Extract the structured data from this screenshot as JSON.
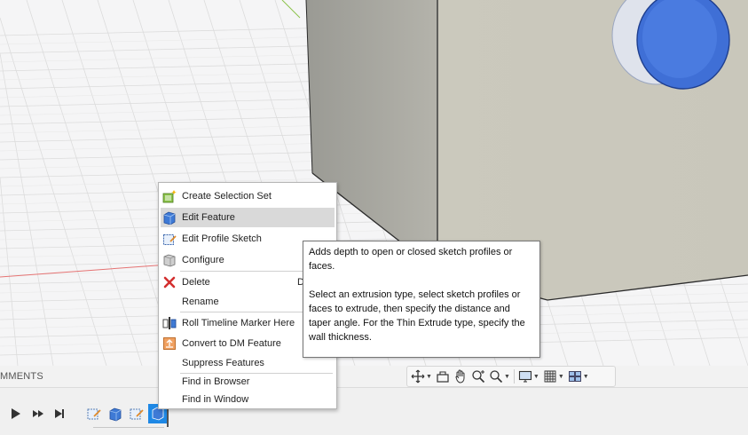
{
  "viewport": {
    "label": "3d-viewport"
  },
  "comments": {
    "label": "MMENTS"
  },
  "context_menu": {
    "items": [
      {
        "label": "Create Selection Set",
        "icon": "selection-set-icon"
      },
      {
        "label": "Edit Feature",
        "icon": "extrude-feature-icon",
        "highlighted": true
      },
      {
        "label": "Edit Profile Sketch",
        "icon": "profile-sketch-icon"
      },
      {
        "label": "Configure",
        "icon": "configure-icon"
      },
      {
        "label": "Delete",
        "icon": "delete-icon",
        "shortcut": "D"
      },
      {
        "label": "Rename",
        "icon": ""
      },
      {
        "label": "Roll Timeline Marker Here",
        "icon": "timeline-marker-icon"
      },
      {
        "label": "Convert to DM Feature",
        "icon": "convert-dm-icon"
      },
      {
        "label": "Suppress Features",
        "icon": ""
      },
      {
        "label": "Find in Browser",
        "icon": ""
      },
      {
        "label": "Find in Window",
        "icon": ""
      }
    ]
  },
  "tooltip": {
    "summary": "Adds depth to open or closed sketch profiles or faces.",
    "detail": "Select an extrusion type, select sketch profiles or faces to extrude, then specify the distance and taper angle. For the Thin Extrude type, specify the wall thickness."
  },
  "nav_toolbar": {
    "tools": [
      "orbit-icon",
      "look-at-icon",
      "pan-icon",
      "zoom-icon",
      "fit-icon",
      "display-settings-icon",
      "grid-icon",
      "viewports-icon"
    ]
  },
  "timeline": {
    "controls": [
      "play-icon",
      "step-forward-icon",
      "go-to-end-icon"
    ],
    "features": [
      "sketch-feature-icon",
      "extrude-feature-icon",
      "sketch-feature-icon",
      "extrude-feature-icon"
    ],
    "accent_color": "#1e88e5"
  }
}
